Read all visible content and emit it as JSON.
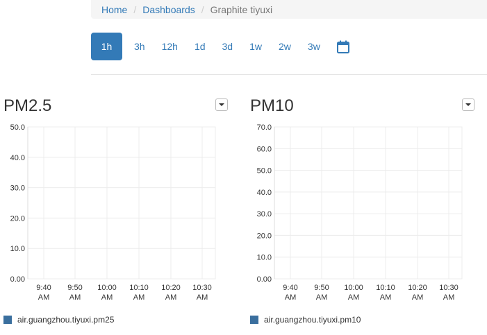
{
  "breadcrumb": {
    "home": "Home",
    "dashboards": "Dashboards",
    "current": "Graphite tiyuxi"
  },
  "time_ranges": [
    "1h",
    "3h",
    "12h",
    "1d",
    "3d",
    "1w",
    "2w",
    "3w"
  ],
  "active_range": "1h",
  "icons": {
    "calendar": "calendar-icon",
    "dropdown": "chevron-down-icon"
  },
  "colors": {
    "accent": "#337ab7",
    "series": "#3a6f9e"
  },
  "panels": [
    {
      "title": "PM2.5",
      "legend": "air.guangzhou.tiyuxi.pm25"
    },
    {
      "title": "PM10",
      "legend": "air.guangzhou.tiyuxi.pm10"
    }
  ],
  "chart_data": [
    {
      "type": "line",
      "title": "PM2.5",
      "series": [
        {
          "name": "air.guangzhou.tiyuxi.pm25",
          "values": []
        }
      ],
      "ylim": [
        0,
        50
      ],
      "y_ticks": [
        "0.00",
        "10.0",
        "20.0",
        "30.0",
        "40.0",
        "50.0"
      ],
      "x_ticks": [
        [
          "9:40",
          "AM"
        ],
        [
          "9:50",
          "AM"
        ],
        [
          "10:00",
          "AM"
        ],
        [
          "10:10",
          "AM"
        ],
        [
          "10:20",
          "AM"
        ],
        [
          "10:30",
          "AM"
        ]
      ],
      "grid": true,
      "legend_position": "bottom-left"
    },
    {
      "type": "line",
      "title": "PM10",
      "series": [
        {
          "name": "air.guangzhou.tiyuxi.pm10",
          "values": []
        }
      ],
      "ylim": [
        0,
        70
      ],
      "y_ticks": [
        "0.00",
        "10.0",
        "20.0",
        "30.0",
        "40.0",
        "50.0",
        "60.0",
        "70.0"
      ],
      "x_ticks": [
        [
          "9:40",
          "AM"
        ],
        [
          "9:50",
          "AM"
        ],
        [
          "10:00",
          "AM"
        ],
        [
          "10:10",
          "AM"
        ],
        [
          "10:20",
          "AM"
        ],
        [
          "10:30",
          "AM"
        ]
      ],
      "grid": true,
      "legend_position": "bottom-left"
    }
  ]
}
